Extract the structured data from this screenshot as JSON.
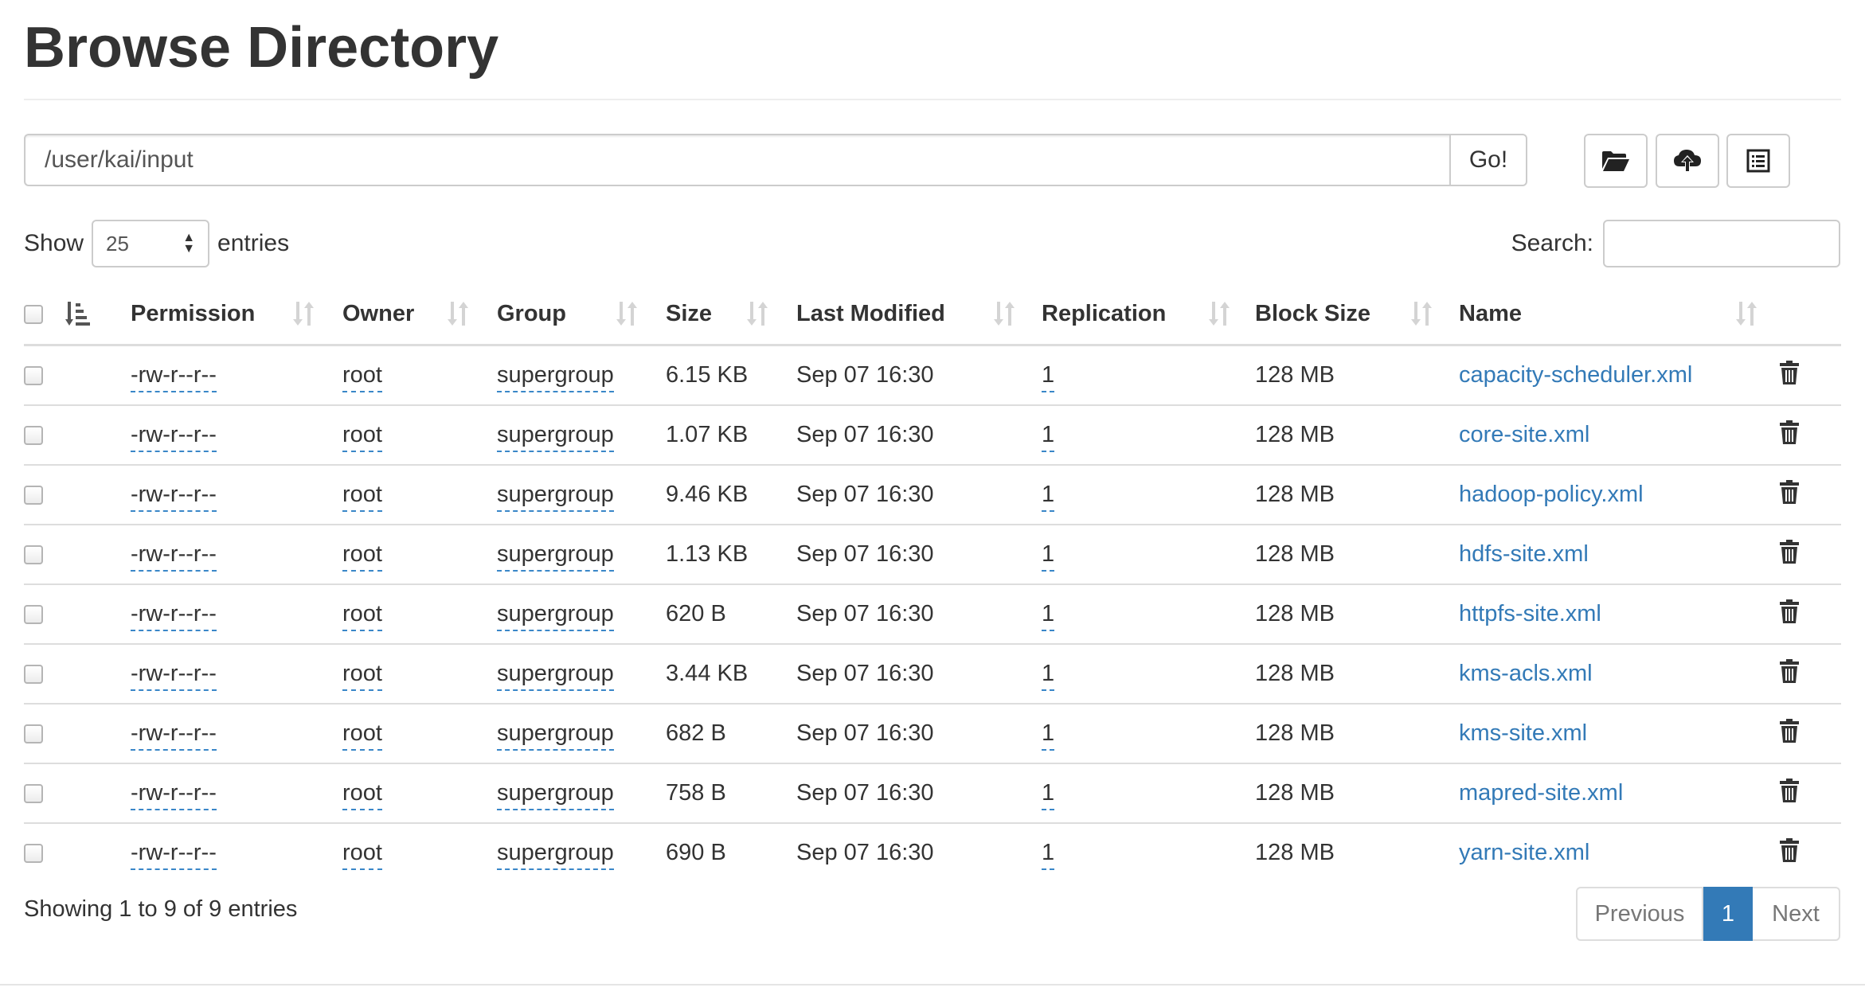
{
  "page": {
    "title": "Browse Directory"
  },
  "pathbar": {
    "path_value": "/user/kai/input",
    "go_label": "Go!",
    "tools": [
      {
        "icon": "folder-open-icon"
      },
      {
        "icon": "cloud-upload-icon"
      },
      {
        "icon": "list-icon"
      }
    ]
  },
  "table_controls": {
    "show_label": "Show",
    "page_size": "25",
    "entries_label": "entries",
    "search_label": "Search:"
  },
  "table": {
    "columns": [
      "Permission",
      "Owner",
      "Group",
      "Size",
      "Last Modified",
      "Replication",
      "Block Size",
      "Name"
    ],
    "rows": [
      {
        "permission": "-rw-r--r--",
        "owner": "root",
        "group": "supergroup",
        "size": "6.15 KB",
        "modified": "Sep 07 16:30",
        "replication": "1",
        "block_size": "128 MB",
        "name": "capacity-scheduler.xml"
      },
      {
        "permission": "-rw-r--r--",
        "owner": "root",
        "group": "supergroup",
        "size": "1.07 KB",
        "modified": "Sep 07 16:30",
        "replication": "1",
        "block_size": "128 MB",
        "name": "core-site.xml"
      },
      {
        "permission": "-rw-r--r--",
        "owner": "root",
        "group": "supergroup",
        "size": "9.46 KB",
        "modified": "Sep 07 16:30",
        "replication": "1",
        "block_size": "128 MB",
        "name": "hadoop-policy.xml"
      },
      {
        "permission": "-rw-r--r--",
        "owner": "root",
        "group": "supergroup",
        "size": "1.13 KB",
        "modified": "Sep 07 16:30",
        "replication": "1",
        "block_size": "128 MB",
        "name": "hdfs-site.xml"
      },
      {
        "permission": "-rw-r--r--",
        "owner": "root",
        "group": "supergroup",
        "size": "620 B",
        "modified": "Sep 07 16:30",
        "replication": "1",
        "block_size": "128 MB",
        "name": "httpfs-site.xml"
      },
      {
        "permission": "-rw-r--r--",
        "owner": "root",
        "group": "supergroup",
        "size": "3.44 KB",
        "modified": "Sep 07 16:30",
        "replication": "1",
        "block_size": "128 MB",
        "name": "kms-acls.xml"
      },
      {
        "permission": "-rw-r--r--",
        "owner": "root",
        "group": "supergroup",
        "size": "682 B",
        "modified": "Sep 07 16:30",
        "replication": "1",
        "block_size": "128 MB",
        "name": "kms-site.xml"
      },
      {
        "permission": "-rw-r--r--",
        "owner": "root",
        "group": "supergroup",
        "size": "758 B",
        "modified": "Sep 07 16:30",
        "replication": "1",
        "block_size": "128 MB",
        "name": "mapred-site.xml"
      },
      {
        "permission": "-rw-r--r--",
        "owner": "root",
        "group": "supergroup",
        "size": "690 B",
        "modified": "Sep 07 16:30",
        "replication": "1",
        "block_size": "128 MB",
        "name": "yarn-site.xml"
      }
    ]
  },
  "footer": {
    "info": "Showing 1 to 9 of 9 entries",
    "previous_label": "Previous",
    "current_page": "1",
    "next_label": "Next"
  },
  "colors": {
    "link": "#337ab7",
    "active_page": "#337ab7",
    "border": "#dddddd"
  }
}
